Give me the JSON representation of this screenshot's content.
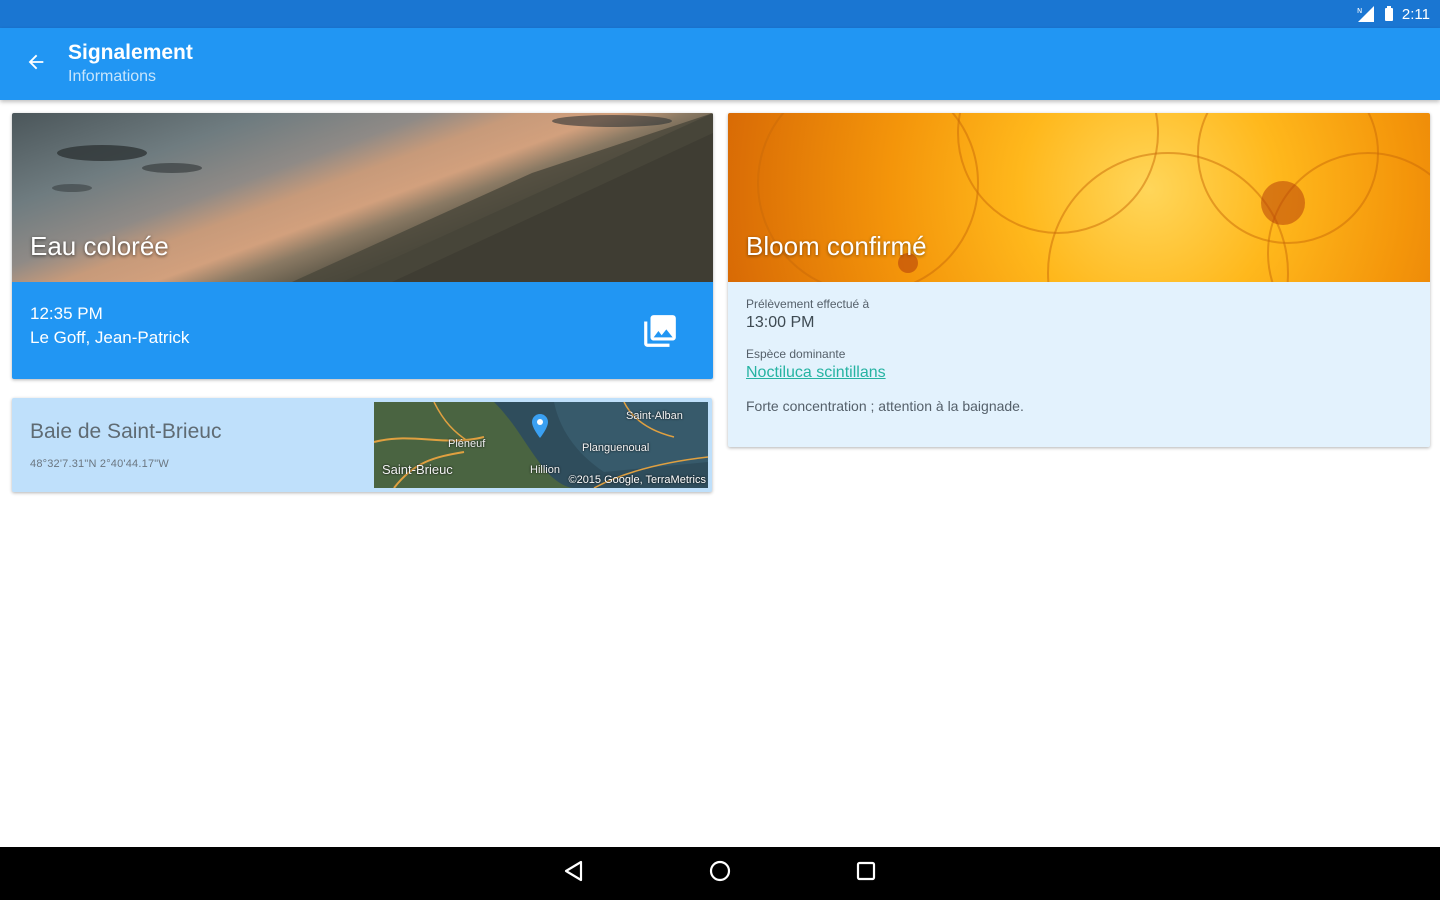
{
  "status_bar": {
    "time": "2:11"
  },
  "app_bar": {
    "title": "Signalement",
    "subtitle": "Informations"
  },
  "report_card": {
    "hero_title": "Eau colorée",
    "time": "12:35 PM",
    "author": "Le Goff, Jean-Patrick"
  },
  "location_card": {
    "name": "Baie de Saint-Brieuc",
    "coordinates": "48°32'7.31\"N 2°40'44.17\"W",
    "map_labels": {
      "saint_alban": "Saint-Alban",
      "pleneuf": "Pléneuf",
      "planguenoual": "Planguenoual",
      "saint_brieuc": "Saint-Brieuc",
      "hillion": "Hillion"
    },
    "map_credit": "©2015 Google, TerraMetrics"
  },
  "bloom_card": {
    "hero_title": "Bloom confirmé",
    "sampling_label": "Prélèvement effectué à",
    "sampling_time": "13:00 PM",
    "species_label": "Espèce dominante",
    "species_value": "Noctiluca scintillans",
    "note": "Forte concentration ; attention à la baignade."
  },
  "colors": {
    "status_bar": "#1a76d2",
    "app_bar": "#2196f3",
    "card_blue": "#2196f3",
    "location_bg": "#bfe0fb",
    "bloom_bg": "#e3f2fd",
    "link": "#26b3a2"
  },
  "icons": {
    "back": "arrow-left-icon",
    "gallery": "photo-library-icon",
    "map_pin": "map-pin-icon",
    "nav_back": "triangle-back-icon",
    "nav_home": "circle-home-icon",
    "nav_recents": "square-recents-icon"
  }
}
